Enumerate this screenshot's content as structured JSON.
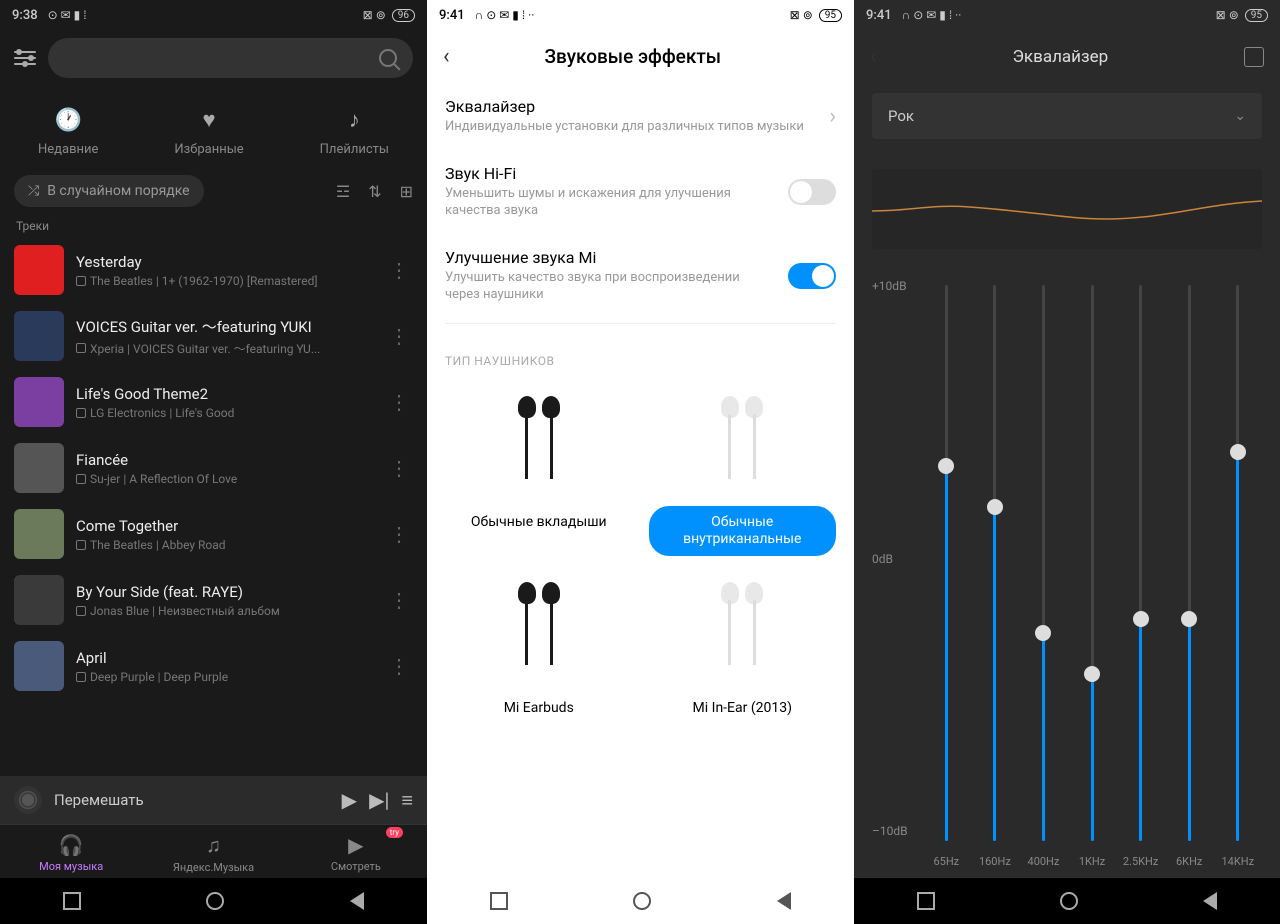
{
  "s1": {
    "status": {
      "time": "9:38",
      "battery": "96"
    },
    "cats": [
      "Недавние",
      "Избранные",
      "Плейлисты"
    ],
    "shuffle": "В случайном порядке",
    "section": "Треки",
    "tracks": [
      {
        "title": "Yesterday",
        "sub": "The Beatles | 1+ (1962-1970) [Remastered]",
        "art": "#e02020"
      },
      {
        "title": "VOICES Guitar ver. ～featuring YUKI",
        "sub": "Xperia | VOICES Guitar ver. ～featuring YU...",
        "art": "#2a3a5a"
      },
      {
        "title": "Life's Good Theme2",
        "sub": "LG Electronics | Life's Good",
        "art": "#7a3fa0"
      },
      {
        "title": "Fiancée",
        "sub": "Su-jer | A Reflection Of Love",
        "art": "#555"
      },
      {
        "title": "Come Together",
        "sub": "The Beatles | Abbey Road",
        "art": "#6a7a5a"
      },
      {
        "title": "By Your Side (feat. RAYE)",
        "sub": "Jonas Blue | Неизвестный альбом",
        "art": "#3a3a3a"
      },
      {
        "title": "April",
        "sub": "Deep Purple | Deep Purple",
        "art": "#4a5a7a"
      }
    ],
    "np": "Перемешать",
    "nav": [
      "Моя музыка",
      "Яндекс.Музыка",
      "Смотреть"
    ],
    "try": "try"
  },
  "s2": {
    "status": {
      "time": "9:41",
      "battery": "95"
    },
    "title": "Звуковые эффекты",
    "rows": [
      {
        "label": "Эквалайзер",
        "desc": "Индивидуальные установки для различных типов музыки",
        "type": "chev"
      },
      {
        "label": "Звук Hi-Fi",
        "desc": "Уменьшить шумы и искажения для улучшения качества звука",
        "type": "off"
      },
      {
        "label": "Улучшение звука Mi",
        "desc": "Улучшить качество звука при воспроизведении через наушники",
        "type": "on"
      }
    ],
    "hp_section": "ТИП НАУШНИКОВ",
    "hps": [
      {
        "label": "Обычные вкладыши",
        "sel": false,
        "color": "black"
      },
      {
        "label": "Обычные внутриканальные",
        "sel": true,
        "color": "white"
      },
      {
        "label": "Mi Earbuds",
        "sel": false,
        "color": "black"
      },
      {
        "label": "Mi In-Ear (2013)",
        "sel": false,
        "color": "white"
      }
    ]
  },
  "s3": {
    "status": {
      "time": "9:41",
      "battery": "95"
    },
    "title": "Эквалайзер",
    "preset": "Рок",
    "db_labels": [
      "+10dB",
      "0dB",
      "–10dB"
    ],
    "bands": [
      {
        "freq": "65Hz",
        "db": 3.5
      },
      {
        "freq": "160Hz",
        "db": 2
      },
      {
        "freq": "400Hz",
        "db": -2.5
      },
      {
        "freq": "1KHz",
        "db": -4
      },
      {
        "freq": "2.5KHz",
        "db": -2
      },
      {
        "freq": "6KHz",
        "db": -2
      },
      {
        "freq": "14KHz",
        "db": 4
      }
    ]
  }
}
